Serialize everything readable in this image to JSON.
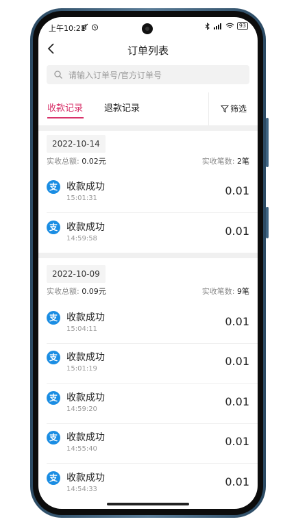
{
  "status_bar": {
    "time": "上午10:21",
    "battery": "93"
  },
  "header": {
    "title": "订单列表"
  },
  "search": {
    "placeholder": "请输入订单号/官方订单号"
  },
  "tabs": [
    {
      "label": "收款记录",
      "active": true
    },
    {
      "label": "退款记录",
      "active": false
    }
  ],
  "filter_label": "筛选",
  "colors": {
    "accent": "#d8326a",
    "alipay_blue": "#1a8de3"
  },
  "groups": [
    {
      "date": "2022-10-14",
      "total_label": "实收总额:",
      "total_value": "0.02元",
      "count_label": "实收笔数:",
      "count_value": "2笔",
      "records": [
        {
          "icon": "alipay-icon",
          "title": "收款成功",
          "time": "15:01:31",
          "amount": "0.01"
        },
        {
          "icon": "alipay-icon",
          "title": "收款成功",
          "time": "14:59:58",
          "amount": "0.01"
        }
      ]
    },
    {
      "date": "2022-10-09",
      "total_label": "实收总额:",
      "total_value": "0.09元",
      "count_label": "实收笔数:",
      "count_value": "9笔",
      "records": [
        {
          "icon": "alipay-icon",
          "title": "收款成功",
          "time": "15:04:11",
          "amount": "0.01"
        },
        {
          "icon": "alipay-icon",
          "title": "收款成功",
          "time": "15:01:19",
          "amount": "0.01"
        },
        {
          "icon": "alipay-icon",
          "title": "收款成功",
          "time": "14:59:20",
          "amount": "0.01"
        },
        {
          "icon": "alipay-icon",
          "title": "收款成功",
          "time": "14:55:40",
          "amount": "0.01"
        },
        {
          "icon": "alipay-icon",
          "title": "收款成功",
          "time": "14:54:33",
          "amount": "0.01"
        }
      ]
    }
  ]
}
